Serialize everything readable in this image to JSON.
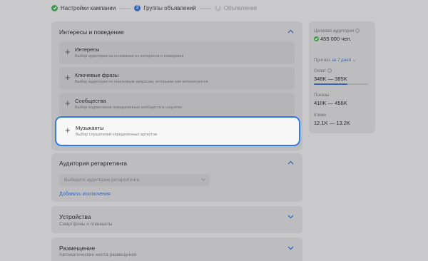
{
  "steps": [
    {
      "label": "Настройки кампании",
      "num": "",
      "state": "done"
    },
    {
      "label": "Группы объявлений",
      "num": "2",
      "state": "active"
    },
    {
      "label": "Объявления",
      "num": "3",
      "state": "next"
    }
  ],
  "interests": {
    "title": "Интересы и поведение",
    "options": [
      {
        "title": "Интересы",
        "desc": "Выбор аудитории на основании их интересов и поведения"
      },
      {
        "title": "Ключевые фразы",
        "desc": "Выбор аудитории по поисковым запросам, которыми они интересуются"
      },
      {
        "title": "Сообщества",
        "desc": "Выбор подписчиков определенных сообществ в соцсетях"
      },
      {
        "title": "Музыканты",
        "desc": "Выбор слушателей определенных артистов"
      }
    ]
  },
  "retargeting": {
    "title": "Аудитория ретаргетинга",
    "select_placeholder": "Выберите аудиторию ретаргетинга",
    "add_exclusions": "Добавить исключения"
  },
  "devices": {
    "title": "Устройства",
    "subtitle": "Смартфоны и планшеты"
  },
  "placement": {
    "title": "Размещение",
    "subtitle": "Автоматические места размещения"
  },
  "sidebar": {
    "target_audience_label": "Целевая аудитория",
    "target_audience_value": "455 000 чел.",
    "forecast_label": "Прогноз",
    "forecast_period": "за 7 дней",
    "reach_label": "Охват",
    "reach_value": "348K — 385K",
    "reach_progress": 0.62,
    "impressions_label": "Показы",
    "impressions_value": "410K — 456K",
    "clicks_label": "Клики",
    "clicks_value": "12.1K — 13.2K"
  },
  "colors": {
    "accent": "#2f7de0",
    "success": "#3f9a4d",
    "link": "#3a68b8"
  }
}
